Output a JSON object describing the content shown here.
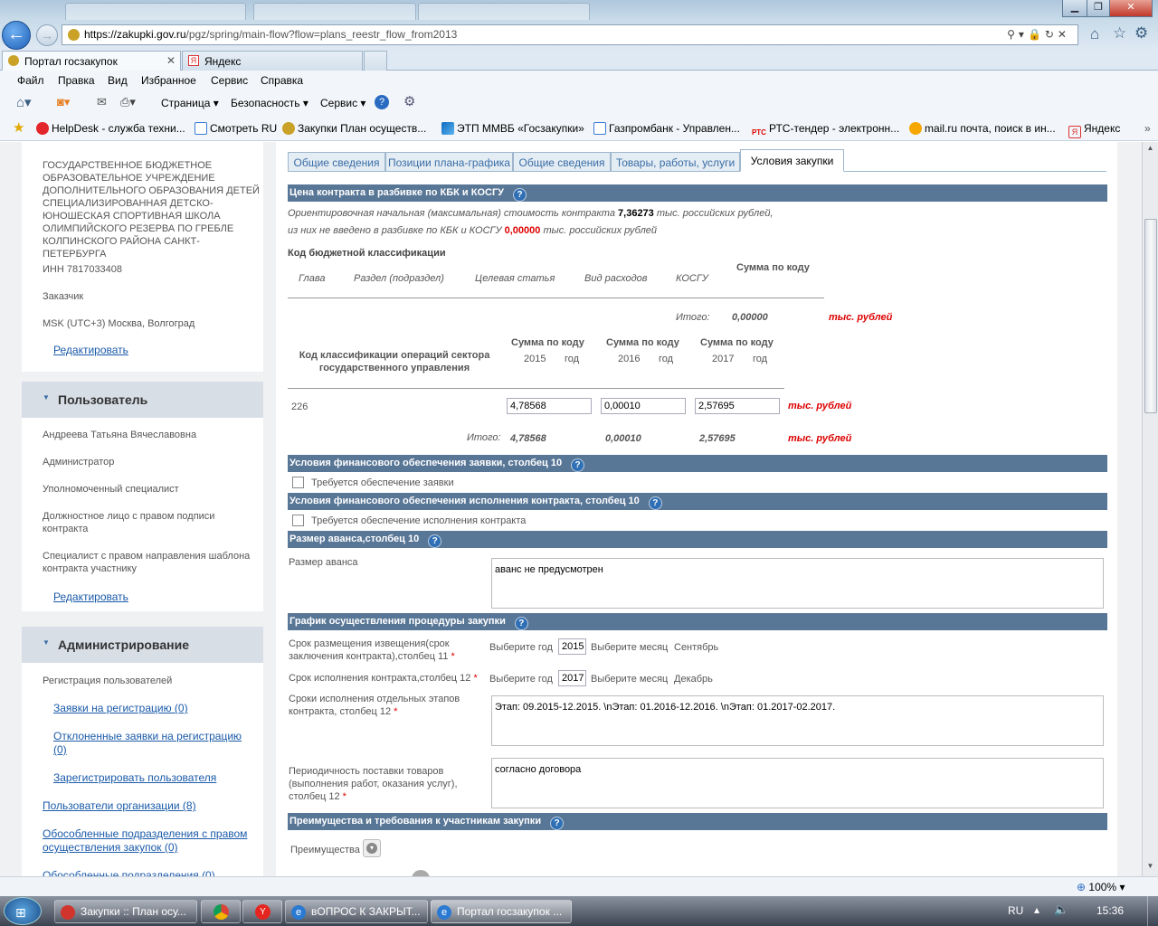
{
  "browser": {
    "url_prefix": "https://zakupki.gov.ru",
    "url_rest": "/pgz/spring/main-flow?flow=plans_reestr_flow_from2013",
    "tabs": [
      "Портал госзакупок",
      "Яндекс"
    ],
    "menu": [
      "Файл",
      "Правка",
      "Вид",
      "Избранное",
      "Сервис",
      "Справка"
    ],
    "commands": [
      "Страница",
      "Безопасность",
      "Сервис"
    ],
    "favorites": [
      "HelpDesk - служба техни...",
      "Смотреть RU",
      "Закупки  План осуществ...",
      "ЭТП ММВБ «Госзакупки»",
      "Газпромбанк - Управлен...",
      "РТС-тендер - электронн...",
      "mail.ru почта, поиск в ин...",
      "Яндекс"
    ],
    "fav_rts_badge": "РТС",
    "zoom": "100%"
  },
  "sidebar": {
    "org_name": "ГОСУДАРСТВЕННОЕ БЮДЖЕТНОЕ ОБРАЗОВАТЕЛЬНОЕ УЧРЕЖДЕНИЕ ДОПОЛНИТЕЛЬНОГО ОБРАЗОВАНИЯ ДЕТЕЙ СПЕЦИАЛИЗИРОВАННАЯ ДЕТСКО-ЮНОШЕСКАЯ СПОРТИВНАЯ ШКОЛА ОЛИМПИЙСКОГО РЕЗЕРВА ПО ГРЕБЛЕ КОЛПИНСКОГО РАЙОНА САНКТ-ПЕТЕРБУРГА",
    "inn": "ИНН 7817033408",
    "role": "Заказчик",
    "timezone": "MSK (UTC+3) Москва, Волгоград",
    "edit_link": "Редактировать",
    "user_title": "Пользователь",
    "user_name": "Андреева Татьяна Вячеславовна",
    "user_roles": [
      "Администратор",
      "Уполномоченный специалист",
      "Должностное лицо с правом подписи контракта",
      "Специалист с правом направления шаблона контракта участнику"
    ],
    "user_edit_link": "Редактировать",
    "admin_title": "Администрирование",
    "admin_reg": "Регистрация пользователей",
    "admin_links": [
      "Заявки на регистрацию (0)",
      "Отклоненные заявки на регистрацию (0)",
      "Зарегистрировать пользователя"
    ],
    "admin_links2": [
      "Пользователи организации (8)",
      "Обособленные подразделения с правом осуществления закупок (0)",
      "Обособленные подразделения (0)"
    ]
  },
  "main": {
    "tabs": [
      "Общие сведения",
      "Позиции плана-графика",
      "Общие сведения",
      "Товары, работы, услуги",
      "Условия закупки"
    ],
    "s1_title": "Цена контракта в разбивке по КБК и КОСГУ",
    "price_line1_a": "Ориентировочная начальная (максимальная) стоимость контракта",
    "price_value": "7,36273",
    "price_line1_b": "тыс. российских рублей,",
    "price_line2_a": "из них не введено в разбивке по КБК и КОСГУ",
    "price_unallocated": "0,00000",
    "price_line2_b": "тыс. российских рублей",
    "kbk_title": "Код бюджетной классификации",
    "kbk_cols": [
      "Глава",
      "Раздел (подраздел)",
      "Целевая статья",
      "Вид расходов",
      "КОСГУ"
    ],
    "kbk_sum": "Сумма по коду",
    "itogo": "Итого:",
    "kbk_total": "0,00000",
    "unit": "тыс. рублей",
    "kosgu_title": "Код классификации операций сектора государственного управления",
    "sum_head": "Сумма по коду",
    "years": [
      "2015",
      "2016",
      "2017"
    ],
    "god": "год",
    "kosgu_code": "226",
    "kosgu_values": [
      "4,78568",
      "0,00010",
      "2,57695"
    ],
    "kosgu_totals": [
      "4,78568",
      "0,00010",
      "2,57695"
    ],
    "s2_title": "Условия финансового обеспечения заявки, столбец 10",
    "s2_check": "Требуется обеспечение заявки",
    "s3_title": "Условия финансового обеспечения исполнения контракта, столбец 10",
    "s3_check": "Требуется обеспечение исполнения контракта",
    "s4_title": "Размер аванса,столбец 10",
    "advance_label": "Размер аванса",
    "advance_value": "аванс не предусмотрен",
    "s5_title": "График осуществления процедуры закупки",
    "g1_label": "Срок размещения извещения(срок заключения контракта),столбец 11",
    "choose_year": "Выберите год",
    "choose_month": "Выберите месяц",
    "g1_year": "2015",
    "g1_month": "Сентябрь",
    "g2_label": "Срок исполнения контракта,столбец 12",
    "g2_year": "2017",
    "g2_month": "Декабрь",
    "g3_label": "Сроки исполнения отдельных этапов контракта, столбец 12",
    "g3_value": "Этап: 09.2015-12.2015. \\nЭтап: 01.2016-12.2016. \\nЭтап: 01.2017-02.2017.",
    "g4_label": "Периодичность поставки товаров (выполнения работ, оказания услуг), столбец 12",
    "g4_value": "согласно договора",
    "s6_title": "Преимущества и требования к участникам закупки",
    "pref_label": "Преимущества"
  },
  "taskbar": {
    "items": [
      "Закупки :: План осу...",
      "вОПРОС К ЗАКРЫТ...",
      "Портал госзакупок ..."
    ],
    "lang": "RU",
    "time": "15:36"
  }
}
